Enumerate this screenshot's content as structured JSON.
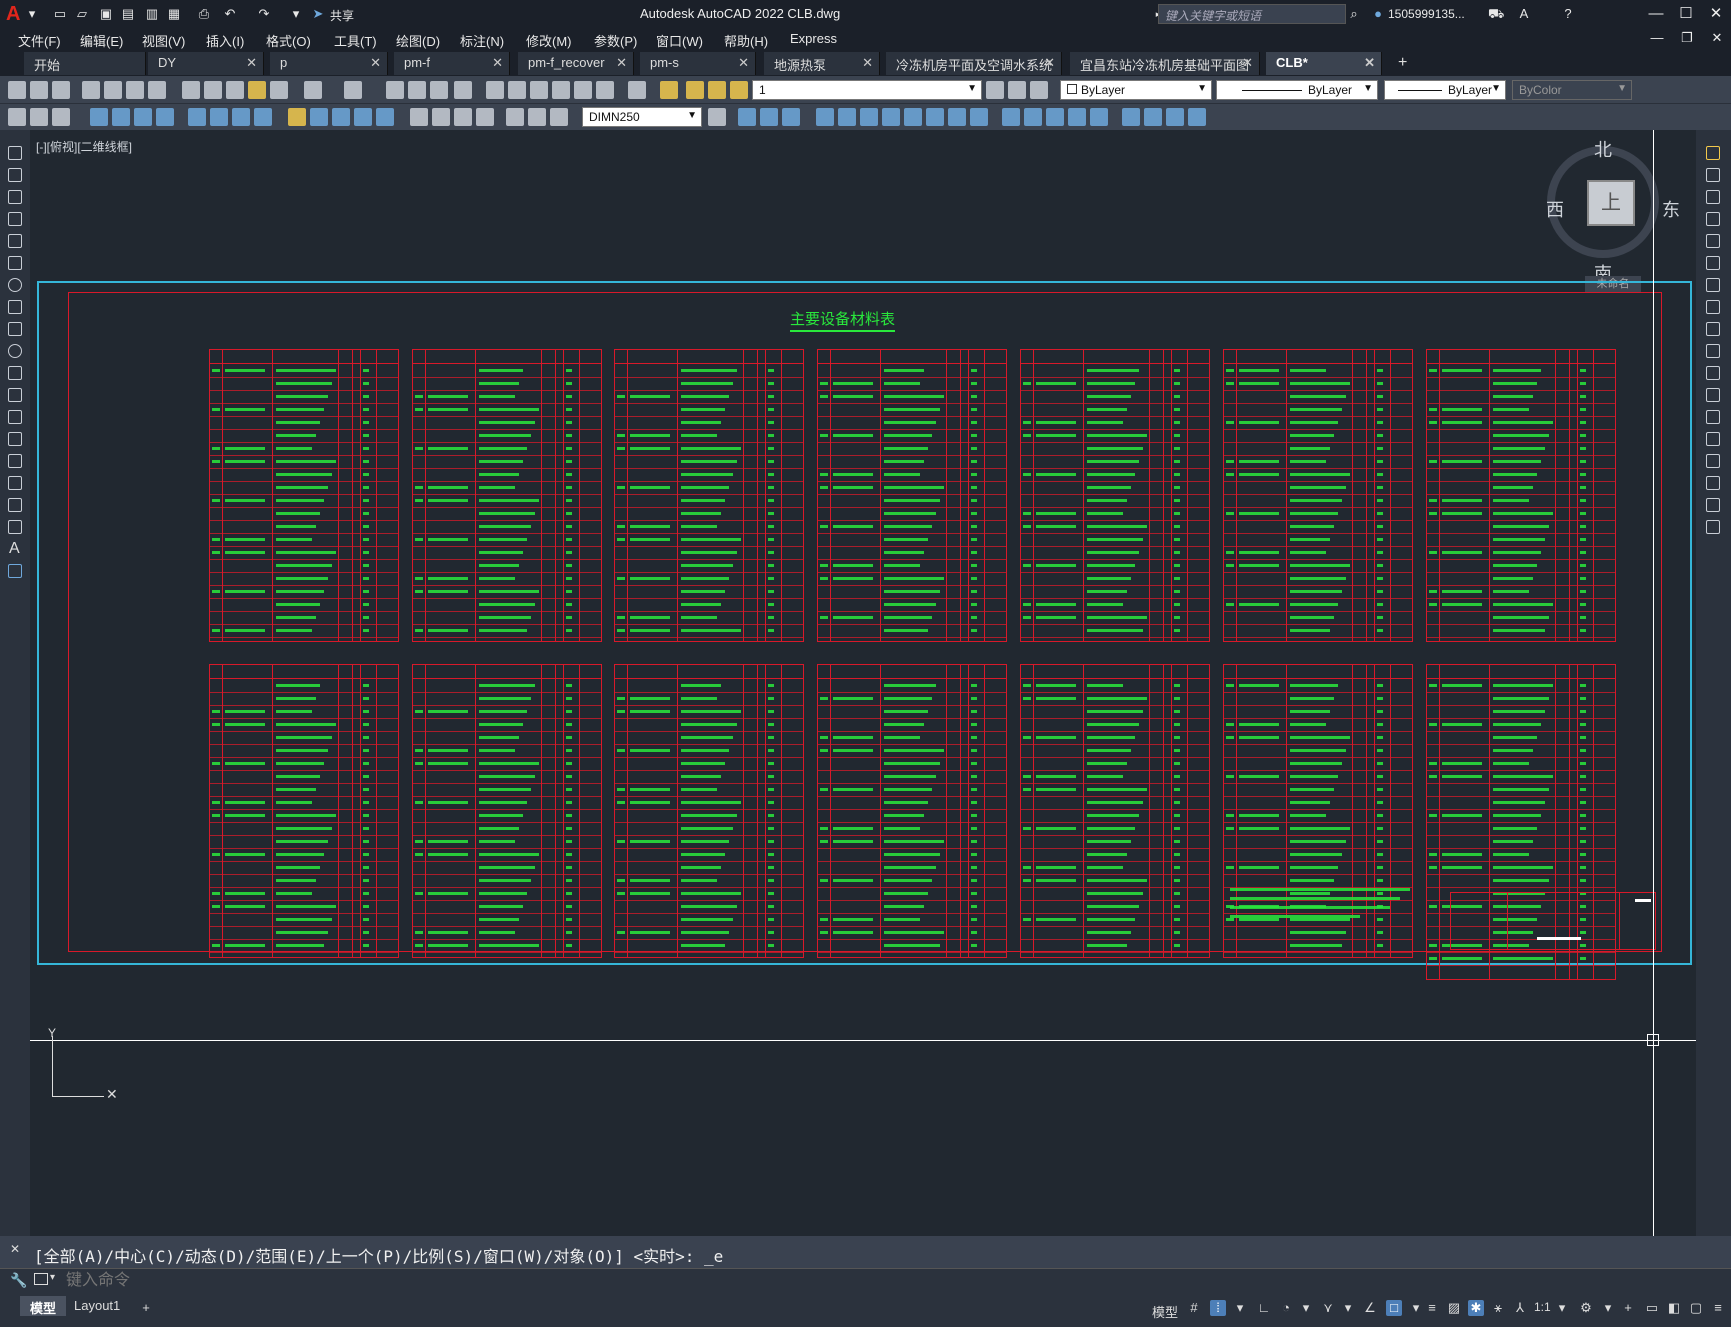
{
  "app": {
    "title": "Autodesk AutoCAD 2022    CLB.dwg",
    "share_label": "共享",
    "search_placeholder": "键入关键字或短语",
    "user": "1505999135...",
    "logo": "A"
  },
  "menu": [
    "文件(F)",
    "编辑(E)",
    "视图(V)",
    "插入(I)",
    "格式(O)",
    "工具(T)",
    "绘图(D)",
    "标注(N)",
    "修改(M)",
    "参数(P)",
    "窗口(W)",
    "帮助(H)",
    "Express"
  ],
  "tabs": [
    {
      "label": "开始",
      "closable": false
    },
    {
      "label": "DY",
      "closable": true
    },
    {
      "label": "p",
      "closable": true
    },
    {
      "label": "pm-f",
      "closable": true
    },
    {
      "label": "pm-f_recover",
      "closable": true
    },
    {
      "label": "pm-s",
      "closable": true
    },
    {
      "label": "地源热泵",
      "closable": true
    },
    {
      "label": "冷冻机房平面及空调水系统",
      "closable": true
    },
    {
      "label": "宜昌东站冷冻机房基础平面图",
      "closable": true
    },
    {
      "label": "CLB*",
      "closable": true,
      "active": true
    }
  ],
  "toolbar": {
    "layer_value": "1",
    "color_value": "ByLayer",
    "linetype_value": "ByLayer",
    "lineweight_value": "ByLayer",
    "plotstyle_value": "ByColor",
    "dimstyle_value": "DIMN250"
  },
  "canvas": {
    "view_label": "[-][俯视][二维线框]",
    "sheet_title": "主要设备材料表",
    "viewcube": {
      "north": "北",
      "south": "南",
      "west": "西",
      "east": "东",
      "face": "上",
      "unnamed": "未命名"
    }
  },
  "command": {
    "history": "[全部(A)/中心(C)/动态(D)/范围(E)/上一个(P)/比例(S)/窗口(W)/对象(O)] <实时>: _e",
    "placeholder": "键入命令"
  },
  "status": {
    "layout_tabs": [
      "模型",
      "Layout1"
    ],
    "model_label": "模型",
    "scale": "1:1"
  },
  "colors": {
    "background": "#212830",
    "table_line": "#d8192a",
    "table_text": "#29e83c",
    "sheet_border": "#35b6d8"
  }
}
